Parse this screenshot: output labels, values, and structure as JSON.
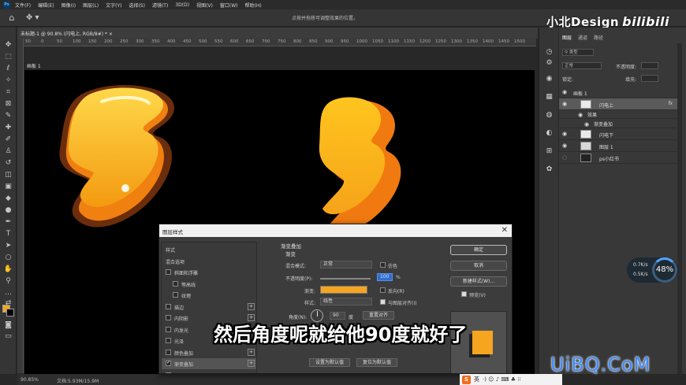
{
  "app": {
    "logo": "Ps",
    "menu": [
      "文件(F)",
      "编辑(E)",
      "图像(I)",
      "图层(L)",
      "文字(Y)",
      "选择(S)",
      "滤镜(T)",
      "3D(D)",
      "视图(V)",
      "窗口(W)",
      "帮助(H)"
    ]
  },
  "options_bar": {
    "hint": "点按并拖移可调整效果的位置。"
  },
  "watermark_top": {
    "text": "小北Design",
    "bili": "bilibili"
  },
  "document": {
    "tab": "未标题-1 @ 90.8% (闪电上, RGB/8#) * ×",
    "artboard": "画板 1",
    "ruler_ticks": [
      "50",
      "0",
      "50",
      "100",
      "150",
      "200",
      "250",
      "300",
      "350",
      "400",
      "450",
      "500",
      "550",
      "600",
      "650",
      "700",
      "750",
      "800",
      "850",
      "900",
      "950",
      "1000",
      "1050",
      "1100",
      "1150",
      "1200",
      "1250",
      "1300",
      "1350",
      "1400",
      "1450",
      "1500"
    ]
  },
  "status_bar": {
    "zoom": "90.85%",
    "docsize": "文档:5.93M/15.9M"
  },
  "layers_panel": {
    "tabs": [
      "图层",
      "通道",
      "路径"
    ],
    "filter_placeholder": "类型",
    "blend_mode": "正常",
    "opacity_label": "不透明度:",
    "lock_label": "锁定:",
    "fill_label": "填充:",
    "layers": [
      {
        "name": "画板 1",
        "kind": "artboard",
        "fx": false,
        "selected": false
      },
      {
        "name": "闪电上",
        "kind": "layer",
        "fx": true,
        "selected": true
      },
      {
        "name": "效果",
        "kind": "effects",
        "fx": false,
        "selected": false
      },
      {
        "name": "渐变叠加",
        "kind": "effect",
        "fx": false,
        "selected": false
      },
      {
        "name": "闪电下",
        "kind": "layer",
        "fx": false,
        "selected": false
      },
      {
        "name": "图层 1",
        "kind": "layer",
        "fx": false,
        "selected": false
      },
      {
        "name": "ps小红书",
        "kind": "layer",
        "fx": false,
        "selected": false
      }
    ]
  },
  "speed_widget": {
    "up": "0.7K/s",
    "down": "0.5K/s",
    "percent": "48%"
  },
  "dialog": {
    "title": "图层样式",
    "close": "✕",
    "styles": [
      {
        "label": "样式",
        "checkbox": false,
        "checked": false,
        "indent": false,
        "plus": false,
        "active": false
      },
      {
        "label": "混合选项",
        "checkbox": false,
        "checked": false,
        "indent": false,
        "plus": false,
        "active": false
      },
      {
        "label": "斜面和浮雕",
        "checkbox": true,
        "checked": false,
        "indent": false,
        "plus": false,
        "active": false
      },
      {
        "label": "等高线",
        "checkbox": true,
        "checked": false,
        "indent": true,
        "plus": false,
        "active": false
      },
      {
        "label": "纹理",
        "checkbox": true,
        "checked": false,
        "indent": true,
        "plus": false,
        "active": false
      },
      {
        "label": "描边",
        "checkbox": true,
        "checked": false,
        "indent": false,
        "plus": true,
        "active": false
      },
      {
        "label": "内阴影",
        "checkbox": true,
        "checked": false,
        "indent": false,
        "plus": true,
        "active": false
      },
      {
        "label": "内发光",
        "checkbox": true,
        "checked": false,
        "indent": false,
        "plus": false,
        "active": false
      },
      {
        "label": "光泽",
        "checkbox": true,
        "checked": false,
        "indent": false,
        "plus": false,
        "active": false
      },
      {
        "label": "颜色叠加",
        "checkbox": true,
        "checked": false,
        "indent": false,
        "plus": true,
        "active": false
      },
      {
        "label": "渐变叠加",
        "checkbox": true,
        "checked": true,
        "indent": false,
        "plus": true,
        "active": true
      },
      {
        "label": "图案叠加",
        "checkbox": true,
        "checked": false,
        "indent": false,
        "plus": false,
        "active": false
      }
    ],
    "section_title": "渐变叠加",
    "group_title": "渐变",
    "blend_mode_label": "混合模式:",
    "blend_mode_value": "正常",
    "dither_label": "仿色",
    "opacity_label": "不透明度(P):",
    "opacity_value": "100",
    "opacity_unit": "%",
    "gradient_label": "渐变:",
    "reverse_label": "反向(R)",
    "style_label": "样式:",
    "style_value": "线性",
    "align_label": "与图层对齐(I)",
    "angle_label": "角度(N):",
    "angle_value": "90",
    "angle_unit": "度",
    "reset_align_button": "重置对齐",
    "default_btn_1": "设置为默认值",
    "default_btn_2": "复位为默认值",
    "ok": "确定",
    "cancel": "取消",
    "new_style": "新建样式(W)...",
    "preview_label": "预览(V)",
    "gradient_color": "#f5a51f"
  },
  "subtitle": "然后角度呢就给他90度就好了",
  "watermark_bottom": "UiBQ.CoM",
  "ime": {
    "logo": "S",
    "lang": "英",
    "icons": "·) ☺ ♪ ⌨ ♣ ⁝⁝"
  }
}
